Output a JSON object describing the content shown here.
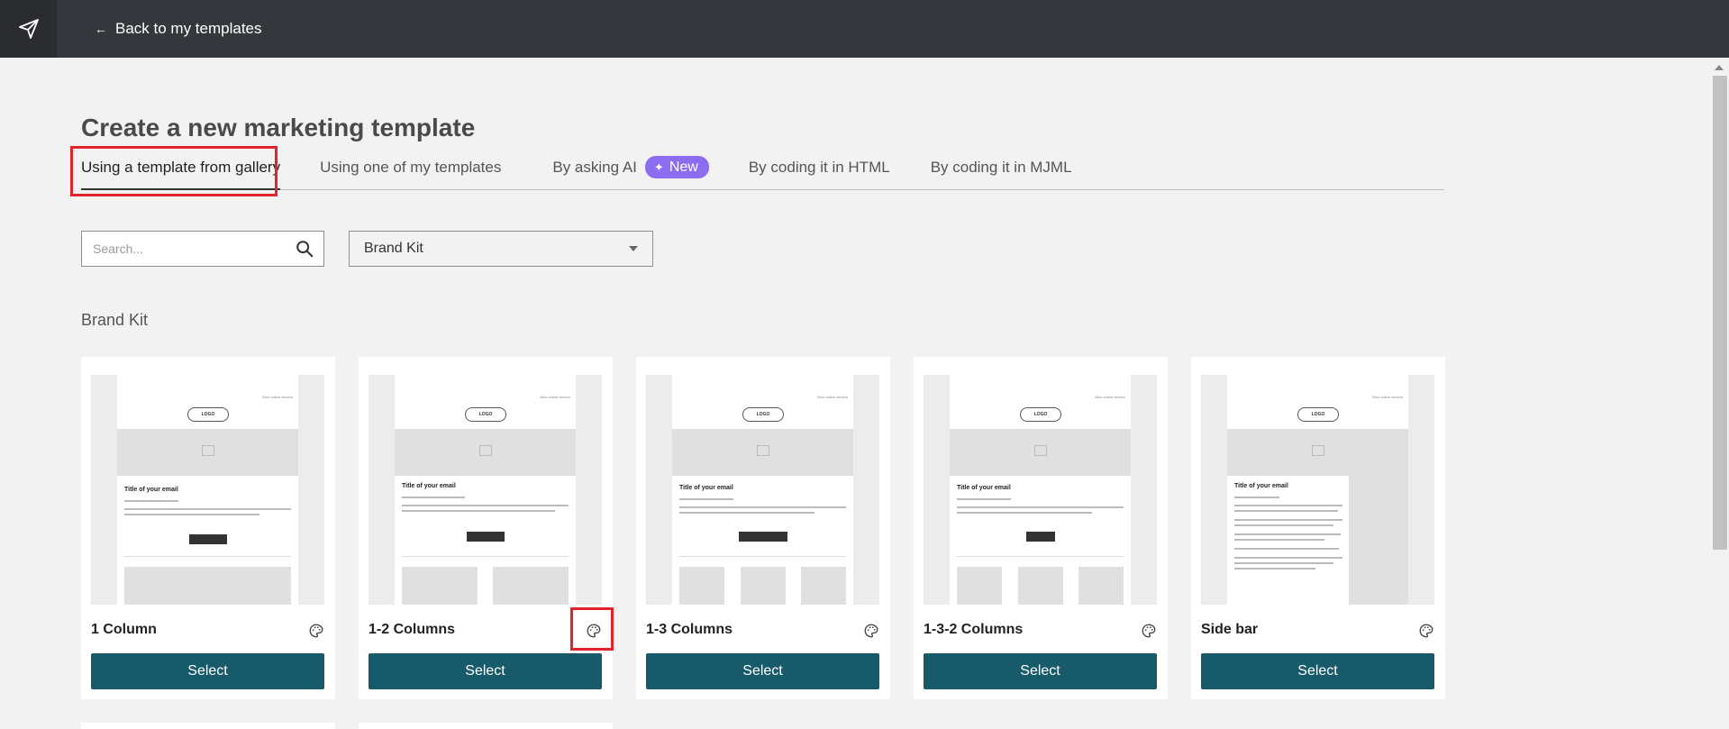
{
  "header": {
    "back_label": "Back to my templates"
  },
  "page": {
    "title": "Create a new marketing template"
  },
  "tabs": [
    {
      "label": "Using a template from gallery",
      "active": true
    },
    {
      "label": "Using one of my templates",
      "active": false
    },
    {
      "label": "By asking AI",
      "badge": "New",
      "active": false
    },
    {
      "label": "By coding it in HTML",
      "active": false
    },
    {
      "label": "By coding it in MJML",
      "active": false
    }
  ],
  "search": {
    "placeholder": "Search...",
    "value": ""
  },
  "filter": {
    "selected": "Brand Kit"
  },
  "section": {
    "title": "Brand Kit"
  },
  "thumbnail": {
    "online_version": "View online version",
    "logo": "LOGO",
    "email_title": "Title of your email"
  },
  "cards": [
    {
      "name": "1 Column",
      "select_label": "Select",
      "icon": "palette-icon"
    },
    {
      "name": "1-2 Columns",
      "select_label": "Select",
      "icon": "palette-icon"
    },
    {
      "name": "1-3 Columns",
      "select_label": "Select",
      "icon": "palette-icon"
    },
    {
      "name": "1-3-2 Columns",
      "select_label": "Select",
      "icon": "palette-icon"
    },
    {
      "name": "Side bar",
      "select_label": "Select",
      "icon": "palette-icon"
    }
  ],
  "colors": {
    "topbar": "#34373c",
    "select_button": "#175b6b",
    "badge": "#8c6df2",
    "highlight": "#e3232c"
  }
}
